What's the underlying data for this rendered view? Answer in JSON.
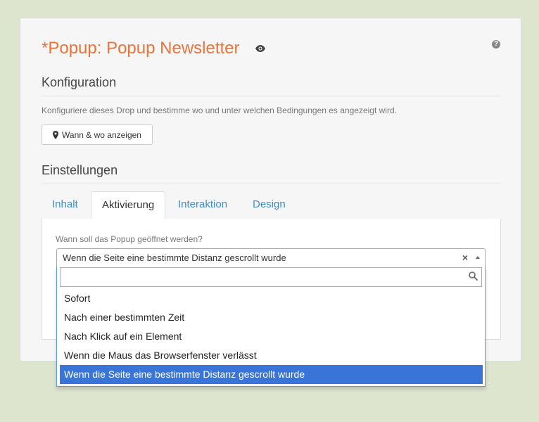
{
  "header": {
    "title": "*Popup: Popup Newsletter",
    "help_icon": "question-circle-icon",
    "visibility_icon": "eye-icon"
  },
  "configuration": {
    "heading": "Konfiguration",
    "description": "Konfiguriere dieses Drop und bestimme wo und unter welchen Bedingungen es angezeigt wird.",
    "button_label": "Wann & wo anzeigen",
    "button_icon": "map-marker-icon"
  },
  "settings": {
    "heading": "Einstellungen",
    "tabs": [
      {
        "label": "Inhalt",
        "active": false
      },
      {
        "label": "Aktivierung",
        "active": true
      },
      {
        "label": "Interaktion",
        "active": false
      },
      {
        "label": "Design",
        "active": false
      }
    ]
  },
  "activation": {
    "question": "Wann soll das Popup geöffnet werden?",
    "selected_value": "Wenn die Seite eine bestimmte Distanz gescrollt wurde",
    "clear_symbol": "×",
    "search_value": "",
    "options": [
      "Sofort",
      "Nach einer bestimmten Zeit",
      "Nach Klick auf ein Element",
      "Wenn die Maus das Browserfenster verlässt",
      "Wenn die Seite eine bestimmte Distanz gescrollt wurde"
    ],
    "selected_index": 4
  },
  "colors": {
    "accent": "#e8743b",
    "link": "#3b8fc4",
    "highlight": "#3875d7",
    "background": "#dde5cf"
  }
}
